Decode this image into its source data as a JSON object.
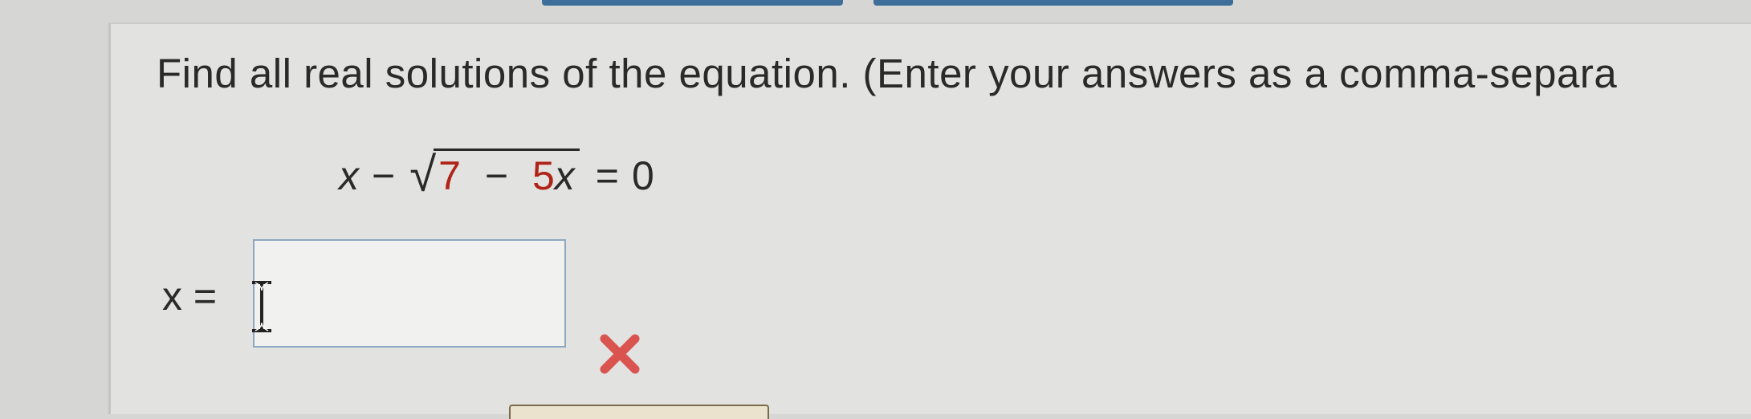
{
  "question": {
    "instruction": "Find all real solutions of the equation. (Enter your answers as a comma-separa",
    "equation": {
      "lhs_var": "x",
      "minus": "−",
      "radical": "√",
      "radicand": {
        "a": "7",
        "minus": "−",
        "coef": "5",
        "var": "x"
      },
      "equals": "=",
      "rhs": "0"
    }
  },
  "answer": {
    "label": "x =",
    "value": "",
    "status": "incorrect",
    "status_icon": "x-mark-icon",
    "status_color": "#d9534f"
  },
  "colors": {
    "radicand_text": "#b02418",
    "input_border": "#8da8c0",
    "top_buttons": "#3d6f9a"
  }
}
